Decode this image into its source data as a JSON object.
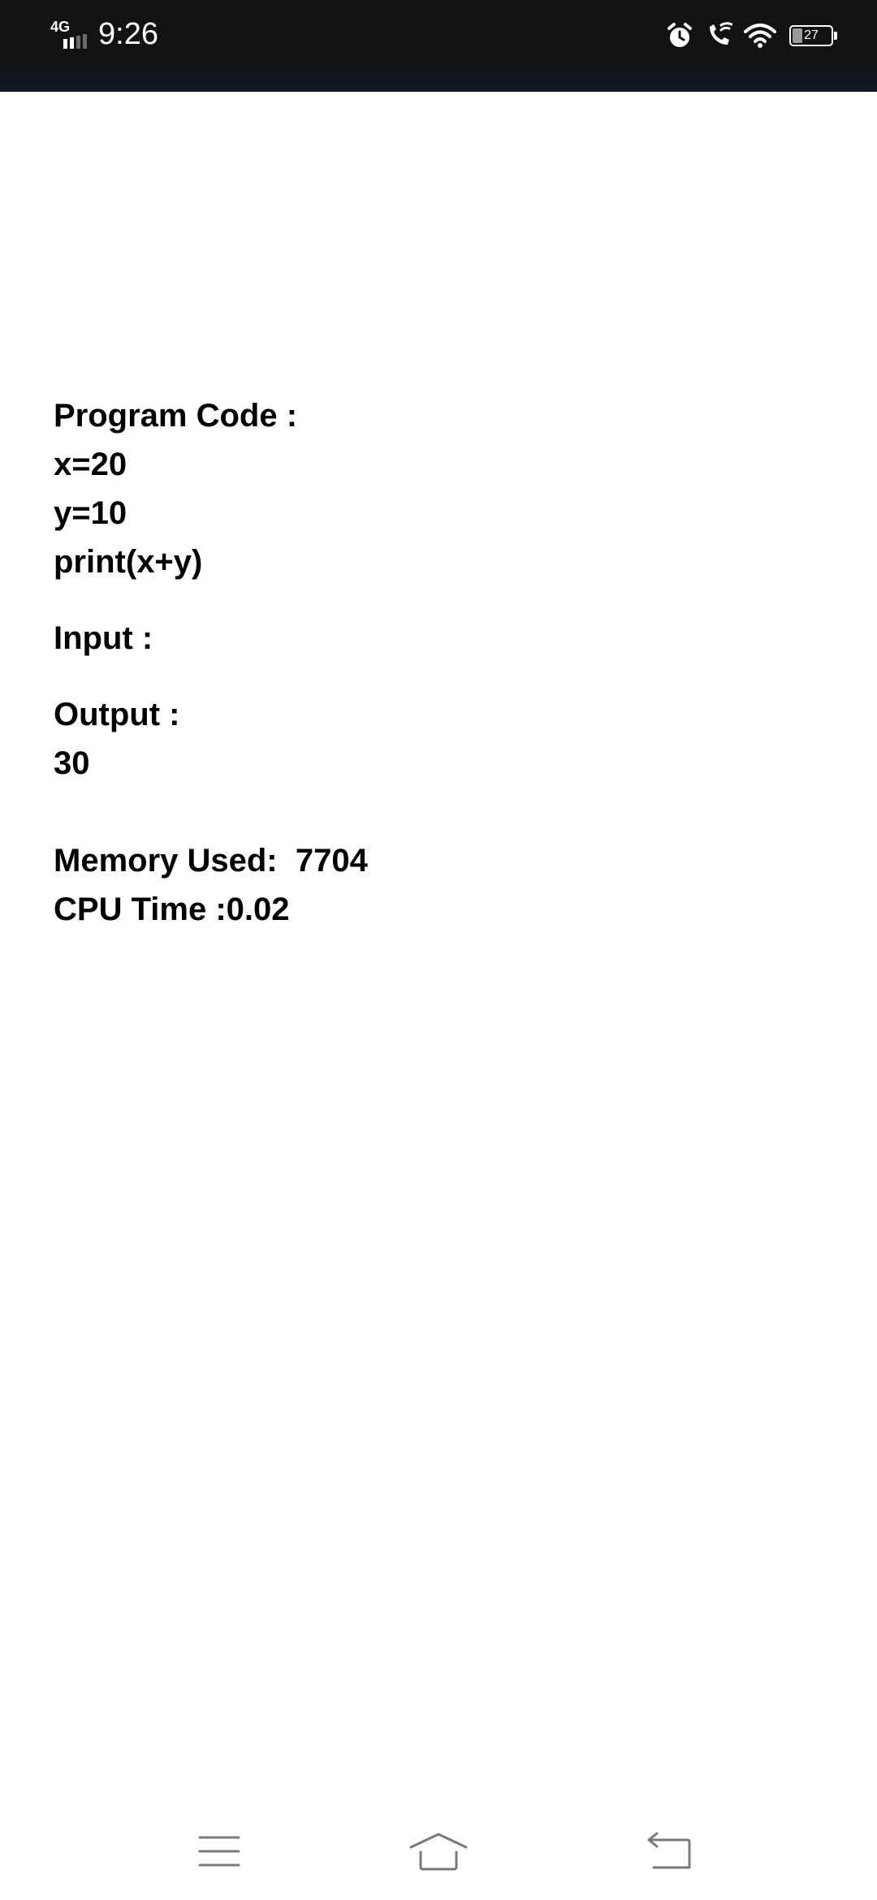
{
  "status_bar": {
    "network": "4G",
    "time": "9:26",
    "battery": "27",
    "battery_level_percent": 27,
    "icons": [
      "signal-icon",
      "alarm-icon",
      "wifi-calling-icon",
      "wifi-icon",
      "battery-icon"
    ]
  },
  "program": {
    "code_label": "Program Code :",
    "code_lines": [
      "x=20",
      "y=10",
      "print(x+y)"
    ],
    "input_label": "Input :",
    "output_label": "Output :",
    "output_value": "30",
    "memory_label": "Memory Used:  7704",
    "cpu_label": "CPU Time :0.02"
  },
  "nav_bar": {
    "icons": [
      "menu-icon",
      "home-icon",
      "back-icon"
    ]
  }
}
